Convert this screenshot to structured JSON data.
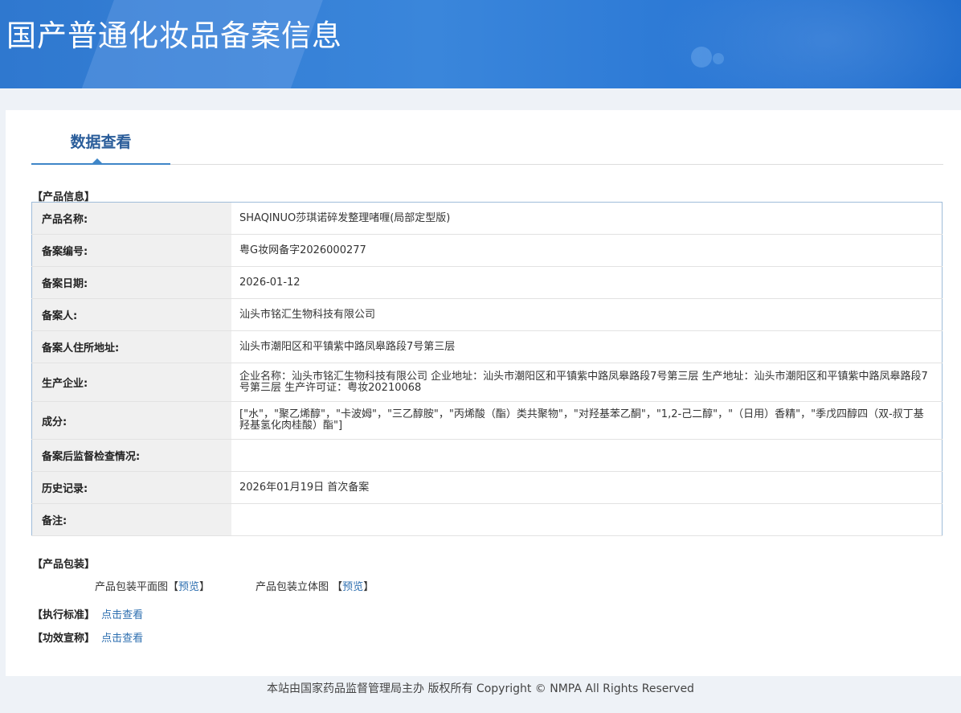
{
  "header": {
    "title": "国产普通化妆品备案信息"
  },
  "tabs": [
    {
      "label": "数据查看"
    }
  ],
  "product_info": {
    "section_label": "【产品信息】",
    "rows": [
      {
        "key": "产品名称:",
        "value": "SHAQINUO莎琪诺碎发整理啫喱(局部定型版)"
      },
      {
        "key": "备案编号:",
        "value": "粤G妆网备字2026000277"
      },
      {
        "key": "备案日期:",
        "value": "2026-01-12"
      },
      {
        "key": "备案人:",
        "value": "汕头市铭汇生物科技有限公司"
      },
      {
        "key": "备案人住所地址:",
        "value": "汕头市潮阳区和平镇紫中路凤皋路段7号第三层"
      },
      {
        "key": "生产企业:",
        "value": "企业名称：汕头市铭汇生物科技有限公司 企业地址：汕头市潮阳区和平镇紫中路凤皋路段7号第三层 生产地址：汕头市潮阳区和平镇紫中路凤皋路段7号第三层 生产许可证：粤妆20210068"
      },
      {
        "key": "成分:",
        "value": "[\"水\"，\"聚乙烯醇\"，\"卡波姆\"，\"三乙醇胺\"，\"丙烯酸（酯）类共聚物\"，\"对羟基苯乙酮\"，\"1,2-己二醇\"，\"（日用）香精\"，\"季戊四醇四（双-叔丁基羟基氢化肉桂酸）酯\"]"
      },
      {
        "key": "备案后监督检查情况:",
        "value": ""
      },
      {
        "key": "历史记录:",
        "value": "2026年01月19日 首次备案"
      },
      {
        "key": "备注:",
        "value": ""
      }
    ]
  },
  "packaging": {
    "section_label": "【产品包装】",
    "flat_label": "产品包装平面图",
    "flat_link": "预览",
    "solid_label": "产品包装立体图",
    "solid_link": "预览"
  },
  "standard": {
    "label": "【执行标准】",
    "link": "点击查看"
  },
  "efficacy": {
    "label": "【功效宣称】",
    "link": "点击查看"
  },
  "footer": {
    "text": "本站由国家药品监督管理局主办 版权所有 Copyright © NMPA All Rights Reserved"
  },
  "colors": {
    "banner": "#2f78cf",
    "link": "#2e6fb0",
    "tab_active": "#3f86c8"
  }
}
